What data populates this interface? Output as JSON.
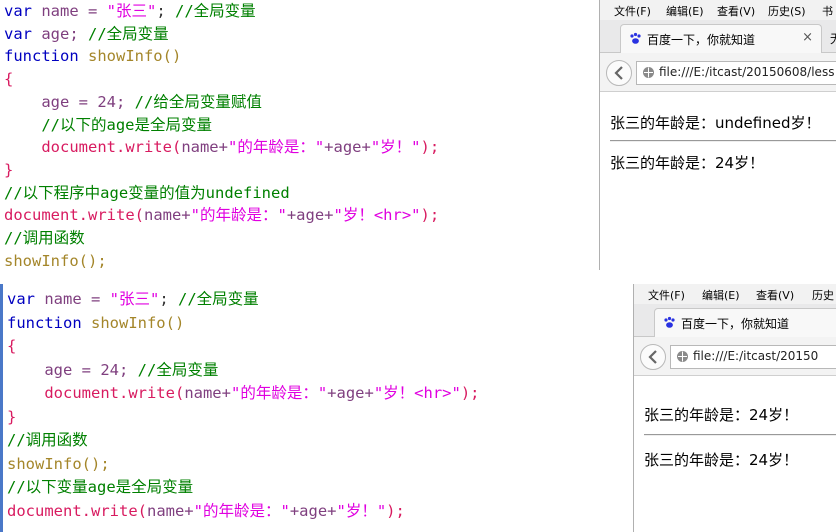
{
  "top": {
    "code_lines": [
      [
        {
          "t": "var",
          "c": "kw"
        },
        {
          "t": " name = ",
          "c": "vr"
        },
        {
          "t": "\"张三\"",
          "c": "str"
        },
        {
          "t": "; ",
          "c": "punct"
        },
        {
          "t": "//全局变量",
          "c": "cm"
        }
      ],
      [
        {
          "t": "var",
          "c": "kw"
        },
        {
          "t": " age; ",
          "c": "vr"
        },
        {
          "t": "//全局变量",
          "c": "cm"
        }
      ],
      [
        {
          "t": "function",
          "c": "kw"
        },
        {
          "t": " showInfo()",
          "c": "fn"
        }
      ],
      [
        {
          "t": "{",
          "c": "mt"
        }
      ],
      [
        {
          "t": "    age = 24; ",
          "c": "vr"
        },
        {
          "t": "//给全局变量赋值",
          "c": "cm"
        }
      ],
      [
        {
          "t": "    //以下的age是全局变量",
          "c": "cm"
        }
      ],
      [
        {
          "t": "    document.write(",
          "c": "mt"
        },
        {
          "t": "name+",
          "c": "vr"
        },
        {
          "t": "\"的年龄是：\"",
          "c": "str"
        },
        {
          "t": "+age+",
          "c": "vr"
        },
        {
          "t": "\"岁！\"",
          "c": "str"
        },
        {
          "t": ");",
          "c": "mt"
        }
      ],
      [
        {
          "t": "}",
          "c": "mt"
        }
      ],
      [
        {
          "t": "//以下程序中age变量的值为undefined",
          "c": "cm"
        }
      ],
      [
        {
          "t": "document.write(",
          "c": "mt"
        },
        {
          "t": "name+",
          "c": "vr"
        },
        {
          "t": "\"的年龄是：\"",
          "c": "str"
        },
        {
          "t": "+age+",
          "c": "vr"
        },
        {
          "t": "\"岁！<hr>\"",
          "c": "str"
        },
        {
          "t": ");",
          "c": "mt"
        }
      ],
      [
        {
          "t": "//调用函数",
          "c": "cm"
        }
      ],
      [
        {
          "t": "showInfo();",
          "c": "fn"
        }
      ]
    ],
    "browser": {
      "menu": [
        "文件(F)",
        "编辑(E)",
        "查看(V)",
        "历史(S)",
        "书"
      ],
      "tab_title": "百度一下，你就知道",
      "tab_close": "×",
      "second_tab": "无",
      "url": "file:///E:/itcast/20150608/less",
      "outputs": [
        "张三的年龄是：undefined岁！",
        "张三的年龄是：24岁！"
      ]
    }
  },
  "bottom": {
    "code_lines": [
      [
        {
          "t": "var",
          "c": "kw"
        },
        {
          "t": " name = ",
          "c": "vr"
        },
        {
          "t": "\"张三\"",
          "c": "str"
        },
        {
          "t": "; ",
          "c": "punct"
        },
        {
          "t": "//全局变量",
          "c": "cm"
        }
      ],
      [
        {
          "t": "function",
          "c": "kw"
        },
        {
          "t": " showInfo()",
          "c": "fn"
        }
      ],
      [
        {
          "t": "{",
          "c": "mt"
        }
      ],
      [
        {
          "t": "    age = 24; ",
          "c": "vr"
        },
        {
          "t": "//全局变量",
          "c": "cm"
        }
      ],
      [
        {
          "t": "    document.write(",
          "c": "mt"
        },
        {
          "t": "name+",
          "c": "vr"
        },
        {
          "t": "\"的年龄是：\"",
          "c": "str"
        },
        {
          "t": "+age+",
          "c": "vr"
        },
        {
          "t": "\"岁！<hr>\"",
          "c": "str"
        },
        {
          "t": ");",
          "c": "mt"
        }
      ],
      [
        {
          "t": "}",
          "c": "mt"
        }
      ],
      [
        {
          "t": "//调用函数",
          "c": "cm"
        }
      ],
      [
        {
          "t": "showInfo();",
          "c": "fn"
        }
      ],
      [
        {
          "t": "//以下变量age是全局变量",
          "c": "cm"
        }
      ],
      [
        {
          "t": "document.write(",
          "c": "mt"
        },
        {
          "t": "name+",
          "c": "vr"
        },
        {
          "t": "\"的年龄是：\"",
          "c": "str"
        },
        {
          "t": "+age+",
          "c": "vr"
        },
        {
          "t": "\"岁！\"",
          "c": "str"
        },
        {
          "t": ");",
          "c": "mt"
        }
      ]
    ],
    "browser": {
      "menu": [
        "文件(F)",
        "编辑(E)",
        "查看(V)",
        "历史"
      ],
      "tab_title": "百度一下，你就知道",
      "url": "file:///E:/itcast/20150",
      "outputs": [
        "张三的年龄是：24岁！",
        "张三的年龄是：24岁！"
      ]
    }
  }
}
